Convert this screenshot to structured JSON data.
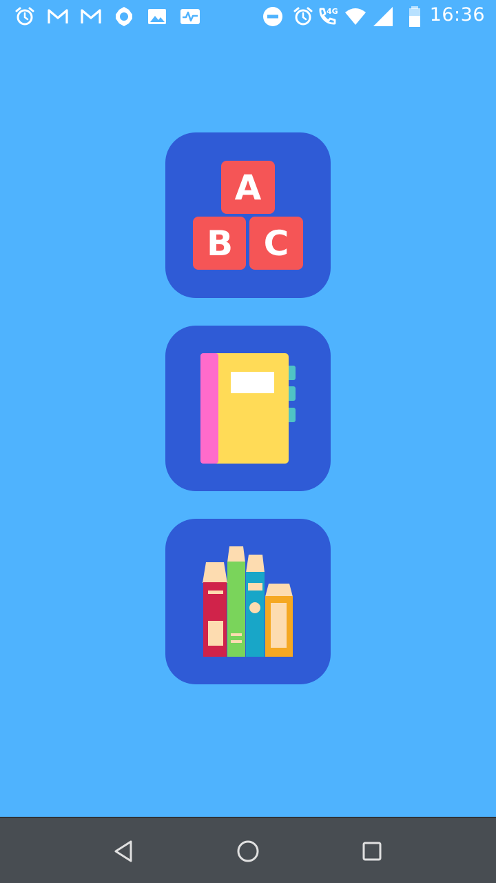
{
  "status_bar": {
    "time": "16:36",
    "network_type": "4G",
    "left_icons": [
      "alarm-icon",
      "gmail-icon",
      "gmail-icon",
      "settings-icon",
      "gallery-icon",
      "activity-icon"
    ],
    "right_icons": [
      "do-not-disturb-icon",
      "alarm-icon",
      "call-icon",
      "wifi-icon",
      "signal-icon",
      "battery-icon"
    ]
  },
  "tiles": [
    {
      "id": "alphabet",
      "icon": "abc-blocks-icon",
      "letters": [
        "A",
        "B",
        "C"
      ]
    },
    {
      "id": "notebook",
      "icon": "notebook-icon"
    },
    {
      "id": "books",
      "icon": "books-icon"
    }
  ],
  "colors": {
    "background": "#4FB3FE",
    "tile": "#2F5BD6",
    "block": "#F55556",
    "nav_bar": "#484D52"
  },
  "nav_bar": {
    "buttons": [
      "back-icon",
      "home-icon",
      "recents-icon"
    ]
  }
}
